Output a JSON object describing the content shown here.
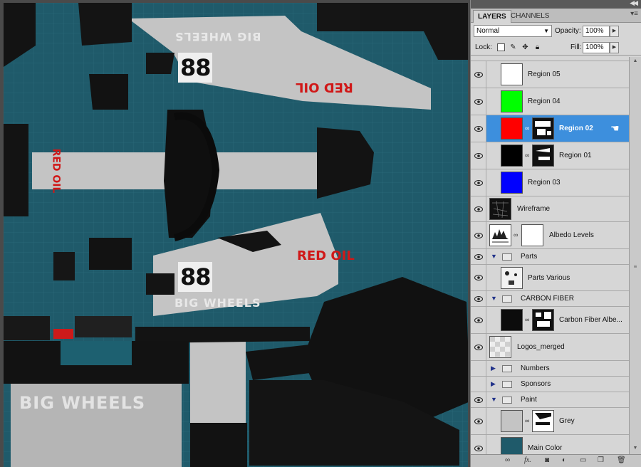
{
  "canvas": {
    "texts": {
      "big_wheels_top": "BIG WHEELS",
      "number_top": "88",
      "red_oil_top": "RED OIL",
      "red_oil_side": "RED OIL",
      "red_oil_mid": "RED OIL",
      "number_bottom": "88",
      "big_wheels_mid": "BIG WHEELS",
      "big_wheels_bottom": "BIG WHEELS"
    },
    "colors": {
      "teal": "#1f5a6a",
      "grey": "#c8c8c8",
      "black": "#111111",
      "red": "#d01818"
    }
  },
  "panel": {
    "tabs": [
      "LAYERS",
      "CHANNELS"
    ],
    "blend_mode": "Normal",
    "opacity_label": "Opacity:",
    "opacity_value": "100%",
    "lock_label": "Lock:",
    "fill_label": "Fill:",
    "fill_value": "100%",
    "layers": [
      {
        "name": "Region 05",
        "thumb": "#ffffff",
        "visible": true
      },
      {
        "name": "Region 04",
        "thumb": "#00ff00",
        "visible": true
      },
      {
        "name": "Region 02",
        "thumb": "#ff0000",
        "visible": true,
        "selected": true
      },
      {
        "name": "Region 01",
        "thumb": "#000000",
        "visible": true
      },
      {
        "name": "Region 03",
        "thumb": "#0000ff",
        "visible": true
      },
      {
        "name": "Wireframe",
        "visible": true
      },
      {
        "name": "Albedo Levels",
        "visible": true
      },
      {
        "name": "Parts",
        "group": true,
        "visible": true
      },
      {
        "name": "Parts Various",
        "visible": true
      },
      {
        "name": "CARBON FIBER",
        "group": true,
        "visible": true
      },
      {
        "name": "Carbon Fiber Albe...",
        "visible": true
      },
      {
        "name": "Logos_merged",
        "visible": true
      },
      {
        "name": "Numbers",
        "group": true,
        "visible": false
      },
      {
        "name": "Sponsors",
        "group": true,
        "visible": false
      },
      {
        "name": "Paint",
        "group": true,
        "visible": true
      },
      {
        "name": "Grey",
        "visible": true
      },
      {
        "name": "Main Color",
        "visible": true
      }
    ],
    "bottom_icons": [
      "link-icon",
      "fx-icon",
      "mask-icon",
      "adjustment-icon",
      "group-icon",
      "new-layer-icon",
      "trash-icon"
    ]
  }
}
